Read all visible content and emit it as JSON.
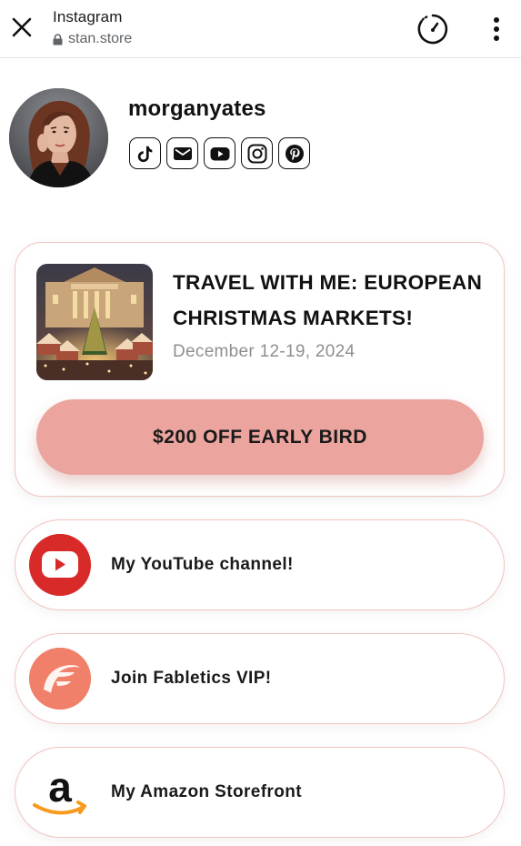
{
  "browser": {
    "title": "Instagram",
    "url": "stan.store"
  },
  "profile": {
    "username": "morganyates",
    "socials": [
      "tiktok-icon",
      "email-icon",
      "youtube-icon",
      "instagram-icon",
      "pinterest-icon"
    ]
  },
  "product": {
    "title": "TRAVEL WITH ME: EUROPEAN CHRISTMAS MARKETS!",
    "date": "December 12-19, 2024",
    "cta_label": "$200 OFF EARLY BIRD"
  },
  "links": [
    {
      "label": "My YouTube channel!",
      "icon": "youtube-logo-icon",
      "color": "#d92a2a"
    },
    {
      "label": "Join Fabletics VIP!",
      "icon": "fabletics-logo-icon",
      "color": "#f0806a"
    },
    {
      "label": "My Amazon Storefront",
      "icon": "amazon-logo-icon",
      "color": "#f79a1e"
    }
  ],
  "colors": {
    "accent": "#eba49e",
    "card_border": "#f1c4bf",
    "date_text": "#8f8f8f"
  }
}
